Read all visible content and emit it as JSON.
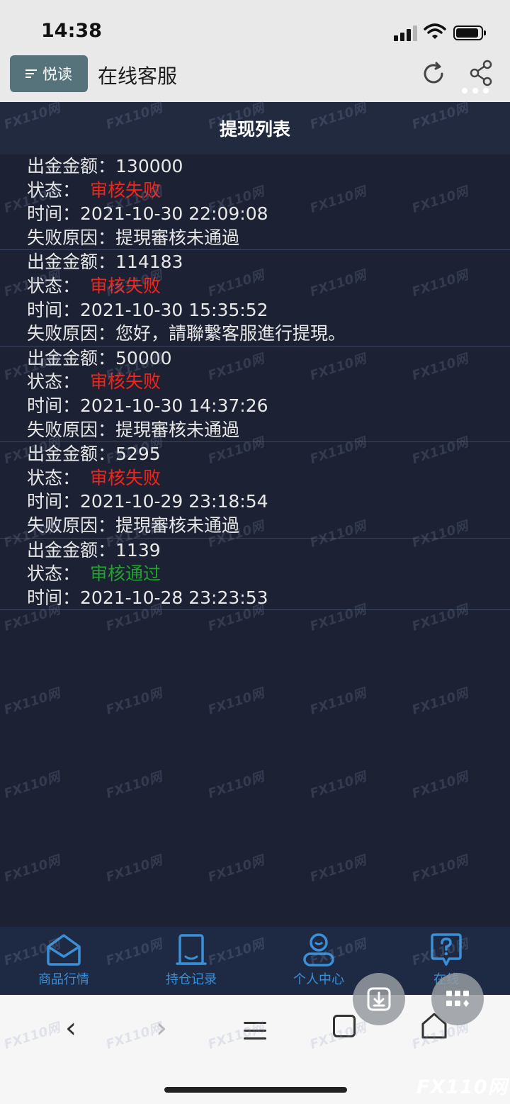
{
  "status_bar": {
    "time": "14:38"
  },
  "app_bar": {
    "read_label": "悦读",
    "title": "在线客服"
  },
  "page": {
    "title": "提现列表"
  },
  "labels": {
    "amount": "出金金额：",
    "status": "状态：",
    "time": "时间：",
    "reason": "失败原因："
  },
  "records": [
    {
      "amount": "130000",
      "status": "审核失败",
      "time": "2021-10-30 22:09:08",
      "reason": "提現審核未通過"
    },
    {
      "amount": "114183",
      "status": "审核失败",
      "time": "2021-10-30 15:35:52",
      "reason": "您好，請聯繫客服進行提現。"
    },
    {
      "amount": "50000",
      "status": "审核失败",
      "time": "2021-10-30 14:37:26",
      "reason": "提現審核未通過"
    },
    {
      "amount": "5295",
      "status": "审核失败",
      "time": "2021-10-29 23:18:54",
      "reason": "提現審核未通過"
    },
    {
      "amount": "1139",
      "status": "审核通过",
      "time": "2021-10-28 23:23:53"
    }
  ],
  "tabs": [
    {
      "label": "商品行情",
      "icon": "market-icon"
    },
    {
      "label": "持仓记录",
      "icon": "holdings-icon"
    },
    {
      "label": "个人中心",
      "icon": "user-icon"
    },
    {
      "label": "在线",
      "icon": "help-icon"
    }
  ],
  "browser": {
    "back": "‹",
    "forward": "›"
  },
  "watermark": "FX110网",
  "colors": {
    "fail": "#f0261c",
    "pass": "#1fa32c",
    "accent": "#3a8fd6",
    "background": "#1c2133"
  }
}
